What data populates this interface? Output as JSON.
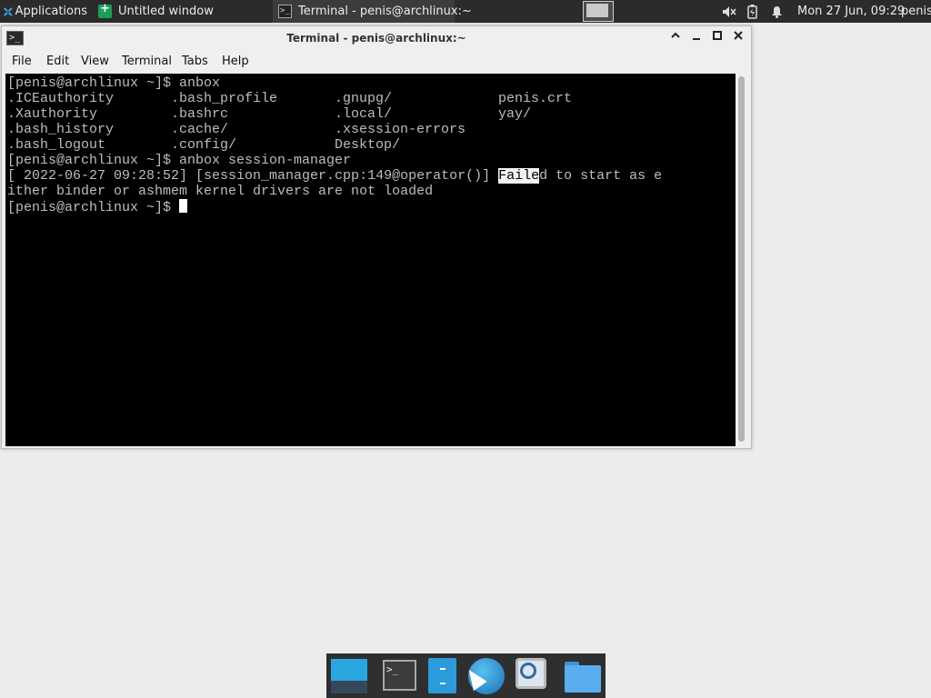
{
  "top_panel": {
    "applications_label": "Applications",
    "tasks": [
      {
        "title": "Untitled window",
        "icon": "green-app-icon"
      },
      {
        "title": "Terminal - penis@archlinux:~",
        "icon": "terminal-icon"
      }
    ],
    "clock": "Mon 27 Jun, 09:29",
    "user": "penis",
    "tray_icons": [
      "volume-muted-icon",
      "battery-charging-icon",
      "bell-icon"
    ]
  },
  "window": {
    "title": "Terminal - penis@archlinux:~",
    "menu": [
      "File",
      "Edit",
      "View",
      "Terminal",
      "Tabs",
      "Help"
    ]
  },
  "terminal": {
    "prompt": "[penis@archlinux ~]$ ",
    "cmd1": "anbox",
    "ls": [
      [
        ".ICEauthority",
        ".bash_profile",
        ".gnupg/",
        "penis.crt"
      ],
      [
        ".Xauthority",
        ".bashrc",
        ".local/",
        "yay/"
      ],
      [
        ".bash_history",
        ".cache/",
        ".xsession-errors",
        ""
      ],
      [
        ".bash_logout",
        ".config/",
        "Desktop/",
        ""
      ]
    ],
    "cmd2": "anbox session-manager",
    "err_prefix": "[ 2022-06-27 09:28:52] [session_manager.cpp:149@operator()] ",
    "err_selected": "Faile",
    "err_rest": "d to start as e",
    "err_line2": "ither binder or ashmem kernel drivers are not loaded"
  },
  "dock": [
    "desktop-icon",
    "terminal-icon",
    "files-icon",
    "web-browser-icon",
    "search-icon",
    "folder-icon"
  ],
  "colors": {
    "panel": "#2b2b2c",
    "terminal_bg": "#000000",
    "terminal_fg": "#bdbdbd",
    "desktop": "#edecea"
  }
}
